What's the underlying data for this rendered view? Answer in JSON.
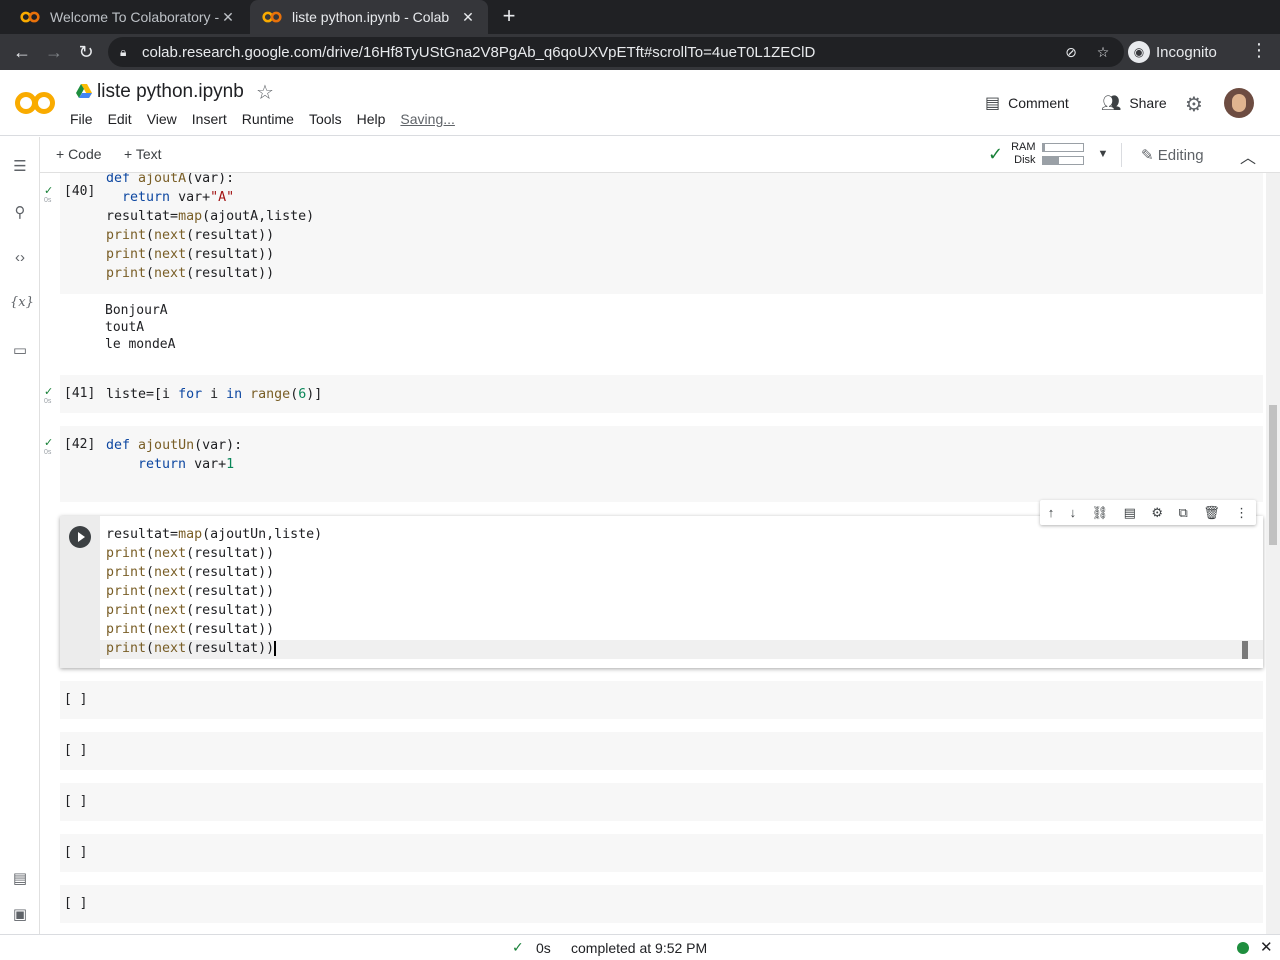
{
  "browser": {
    "tabs": [
      {
        "title": "Welcome To Colaboratory -",
        "close": "✕"
      },
      {
        "title": "liste python.ipynb - Colab",
        "close": "✕"
      }
    ],
    "new_tab": "+",
    "url": "colab.research.google.com/drive/16Hf8TyUStGna2V8PgAb_q6qoUXVpETft#scrollTo=4ueT0L1ZEClD",
    "profile": "Incognito"
  },
  "header": {
    "title": "liste python.ipynb",
    "menu": [
      "File",
      "Edit",
      "View",
      "Insert",
      "Runtime",
      "Tools",
      "Help"
    ],
    "saving": "Saving...",
    "comment_label": "Comment",
    "share_label": "Share"
  },
  "toolbar": {
    "add_code": "+ Code",
    "add_text": "+ Text",
    "ram_label": "RAM",
    "disk_label": "Disk",
    "ram_fraction": 0.05,
    "disk_fraction": 0.4,
    "editing_label": "Editing"
  },
  "cells": {
    "c40": {
      "exec": "[40]",
      "time": "0s"
    },
    "out40": [
      "BonjourA",
      "toutA",
      "le mondeA"
    ],
    "c41": {
      "exec": "[41]",
      "time": "0s"
    },
    "c42": {
      "exec": "[42]",
      "time": "0s"
    },
    "empty_exec": "[ ]"
  },
  "status": {
    "time": "0s",
    "message": "completed at 9:52 PM"
  },
  "colors": {
    "accent": "#f9ab00",
    "ok": "#188038",
    "connected": "#1e8e3e"
  }
}
